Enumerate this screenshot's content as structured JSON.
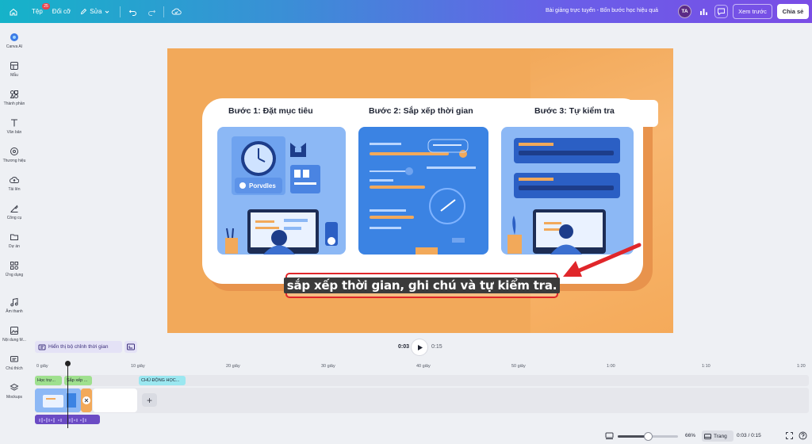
{
  "topbar": {
    "file_label": "Tệp",
    "file_badge": "25",
    "resize_label": "Đổi cỡ",
    "edit_label": "Sửa",
    "doc_title": "Bài giảng trực tuyến - Bốn bước học hiệu quả",
    "avatar_initials": "TA",
    "preview_label": "Xem trước",
    "share_label": "Chia sẻ"
  },
  "sidebar": {
    "items": [
      {
        "label": "Canva AI",
        "icon": "canva-ai-icon"
      },
      {
        "label": "Mẫu",
        "icon": "templates-icon"
      },
      {
        "label": "Thành phần",
        "icon": "elements-icon"
      },
      {
        "label": "Văn bản",
        "icon": "text-icon"
      },
      {
        "label": "Thương hiệu",
        "icon": "brand-icon"
      },
      {
        "label": "Tải lên",
        "icon": "upload-icon"
      },
      {
        "label": "Công cụ",
        "icon": "tools-icon"
      },
      {
        "label": "Dự án",
        "icon": "projects-icon"
      },
      {
        "label": "Ứng dụng",
        "icon": "apps-icon"
      },
      {
        "label": "Âm thanh",
        "icon": "audio-icon"
      },
      {
        "label": "Nội dung M...",
        "icon": "media-icon"
      },
      {
        "label": "Chú thích",
        "icon": "captions-icon"
      },
      {
        "label": "Mockups",
        "icon": "mockups-icon"
      }
    ]
  },
  "slide": {
    "step1_title": "Bước 1: Đặt mục tiêu",
    "step2_title": "Bước 2: Sắp xếp thời gian",
    "step3_title": "Bước 3: Tự kiểm tra",
    "panel1_label": "Porvdles",
    "caption": "sắp xếp thời gian, ghi chú và tự kiểm tra.",
    "colors": {
      "background": "#f2a95a",
      "panel_blue": "#3b83e3",
      "highlight": "#e0262a"
    }
  },
  "playback": {
    "show_timing_label": "Hiển thị bộ chỉnh thời gian",
    "current_time": "0:03",
    "total_time": "0:15"
  },
  "timeline": {
    "ticks": [
      "0 giây",
      "10 giây",
      "20 giây",
      "30 giây",
      "40 giây",
      "50 giây",
      "1:00",
      "1:10",
      "1:20"
    ],
    "clips": [
      {
        "label": "Học trự..."
      },
      {
        "label": "Sắp xếp ..."
      },
      {
        "label": "CHỦ ĐỘNG HỌC..."
      }
    ],
    "add_label": "+"
  },
  "bottombar": {
    "zoom": "66%",
    "zoom_fraction": 0.5,
    "pages_label": "Trang",
    "timecode": "0:03 / 0:15"
  }
}
